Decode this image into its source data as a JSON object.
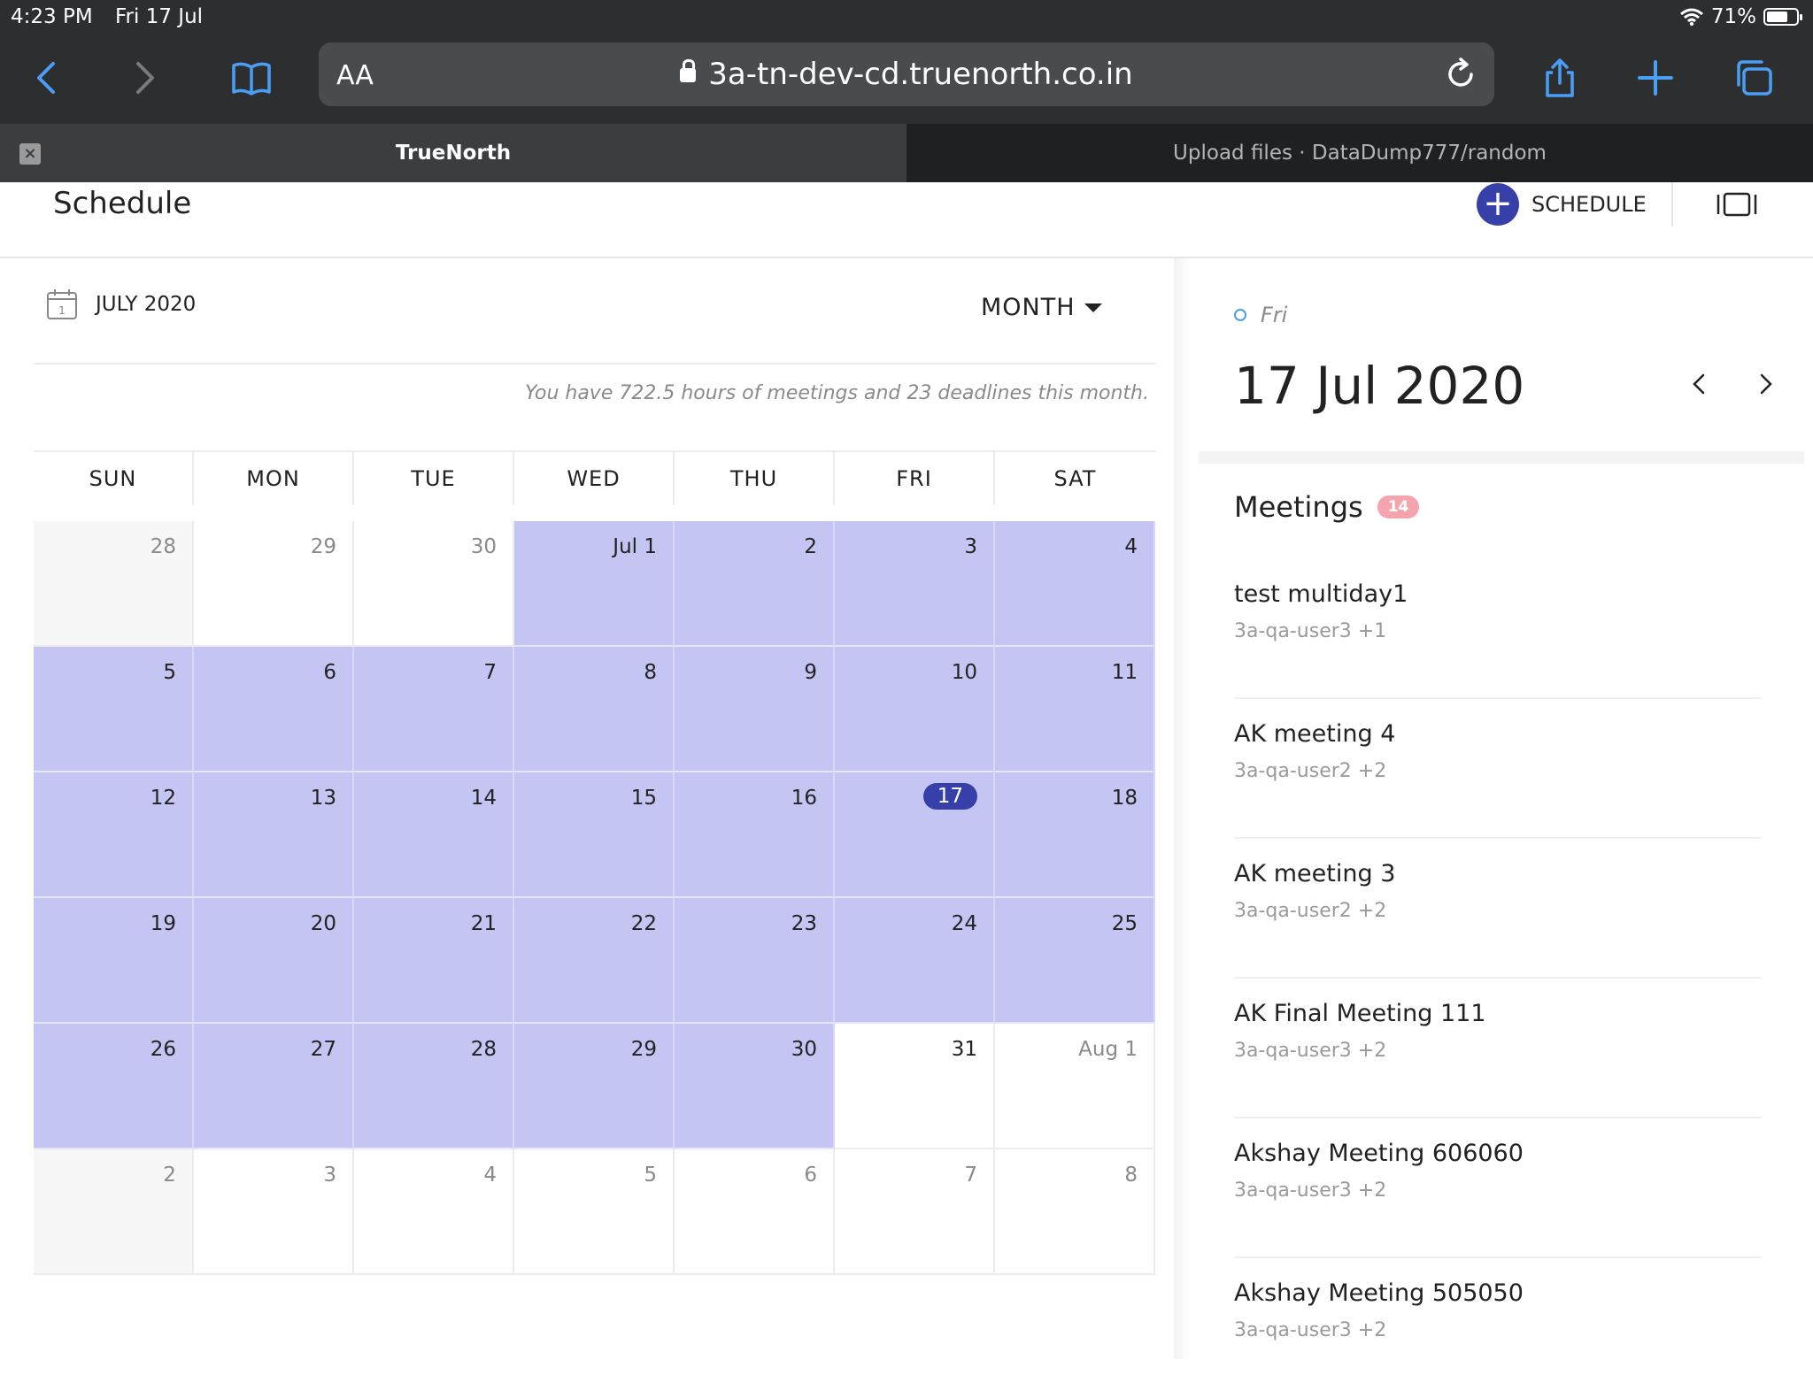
{
  "status_bar": {
    "time": "4:23 PM",
    "date": "Fri 17 Jul",
    "battery": "71%",
    "battery_level": 0.71
  },
  "browser": {
    "text_size_label": "AA",
    "url": "3a-tn-dev-cd.truenorth.co.in",
    "tabs": [
      {
        "title": "TrueNorth",
        "active": true
      },
      {
        "title": "Upload files · DataDump777/random",
        "active": false
      }
    ]
  },
  "header": {
    "title": "Schedule",
    "schedule_button": "SCHEDULE"
  },
  "calendar": {
    "month_label": "JULY 2020",
    "icon_day": "1",
    "view": "MONTH",
    "summary": "You have 722.5 hours of meetings and 23 deadlines this month.",
    "weekdays": [
      "SUN",
      "MON",
      "TUE",
      "WED",
      "THU",
      "FRI",
      "SAT"
    ],
    "days": [
      {
        "label": "28",
        "muted": true,
        "range": false,
        "weekend_out": true
      },
      {
        "label": "29",
        "muted": true,
        "range": false
      },
      {
        "label": "30",
        "muted": true,
        "range": false
      },
      {
        "label": "Jul 1",
        "range": true
      },
      {
        "label": "2",
        "range": true
      },
      {
        "label": "3",
        "range": true
      },
      {
        "label": "4",
        "range": true
      },
      {
        "label": "5",
        "range": true
      },
      {
        "label": "6",
        "range": true
      },
      {
        "label": "7",
        "range": true
      },
      {
        "label": "8",
        "range": true
      },
      {
        "label": "9",
        "range": true
      },
      {
        "label": "10",
        "range": true
      },
      {
        "label": "11",
        "range": true
      },
      {
        "label": "12",
        "range": true
      },
      {
        "label": "13",
        "range": true
      },
      {
        "label": "14",
        "range": true
      },
      {
        "label": "15",
        "range": true
      },
      {
        "label": "16",
        "range": true
      },
      {
        "label": "17",
        "range": true,
        "today": true
      },
      {
        "label": "18",
        "range": true
      },
      {
        "label": "19",
        "range": true
      },
      {
        "label": "20",
        "range": true
      },
      {
        "label": "21",
        "range": true
      },
      {
        "label": "22",
        "range": true
      },
      {
        "label": "23",
        "range": true
      },
      {
        "label": "24",
        "range": true
      },
      {
        "label": "25",
        "range": true
      },
      {
        "label": "26",
        "range": true
      },
      {
        "label": "27",
        "range": true
      },
      {
        "label": "28",
        "range": true
      },
      {
        "label": "29",
        "range": true
      },
      {
        "label": "30",
        "range": true
      },
      {
        "label": "31",
        "range": false
      },
      {
        "label": "Aug 1",
        "muted": true,
        "range": false
      },
      {
        "label": "2",
        "muted": true,
        "range": false,
        "weekend_out": true
      },
      {
        "label": "3",
        "muted": true,
        "range": false
      },
      {
        "label": "4",
        "muted": true,
        "range": false
      },
      {
        "label": "5",
        "muted": true,
        "range": false
      },
      {
        "label": "6",
        "muted": true,
        "range": false
      },
      {
        "label": "7",
        "muted": true,
        "range": false
      },
      {
        "label": "8",
        "muted": true,
        "range": false
      }
    ]
  },
  "day_panel": {
    "weekday": "Fri",
    "date": "17 Jul 2020",
    "meetings_label": "Meetings",
    "meetings_count": "14",
    "meetings": [
      {
        "name": "test multiday1",
        "attendees": "3a-qa-user3 +1"
      },
      {
        "name": "AK meeting 4",
        "attendees": "3a-qa-user2 +2"
      },
      {
        "name": "AK meeting 3",
        "attendees": "3a-qa-user2 +2"
      },
      {
        "name": "AK Final Meeting 111",
        "attendees": "3a-qa-user3 +2"
      },
      {
        "name": "Akshay Meeting 606060",
        "attendees": "3a-qa-user3 +2"
      },
      {
        "name": "Akshay Meeting 505050",
        "attendees": "3a-qa-user3 +2"
      }
    ]
  },
  "colors": {
    "accent": "#3640a8",
    "range_fill": "#c5c5f4",
    "badge": "#f5a3ac",
    "safari_blue": "#4a9ff5"
  },
  "icons": [
    "back-icon",
    "forward-icon",
    "bookmarks-icon",
    "lock-icon",
    "reload-icon",
    "share-icon",
    "new-tab-icon",
    "tabs-icon",
    "wifi-icon",
    "battery-icon",
    "calendar-icon",
    "panel-toggle-icon",
    "chevron-left-icon",
    "chevron-right-icon"
  ]
}
